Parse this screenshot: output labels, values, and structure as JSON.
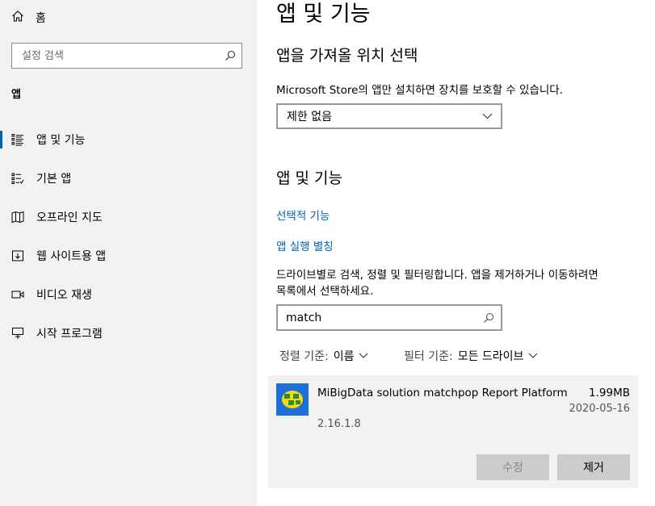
{
  "sidebar": {
    "home_label": "홈",
    "search_placeholder": "설정 검색",
    "section_title": "앱",
    "items": [
      {
        "label": "앱 및 기능",
        "icon": "apps-features-icon",
        "active": true
      },
      {
        "label": "기본 앱",
        "icon": "default-apps-icon"
      },
      {
        "label": "오프라인 지도",
        "icon": "offline-maps-icon"
      },
      {
        "label": "웹 사이트용 앱",
        "icon": "apps-for-websites-icon"
      },
      {
        "label": "비디오 재생",
        "icon": "video-playback-icon"
      },
      {
        "label": "시작 프로그램",
        "icon": "startup-icon"
      }
    ]
  },
  "main": {
    "page_title": "앱 및 기능",
    "source_title": "앱을 가져올 위치 선택",
    "source_desc": "Microsoft Store의 앱만 설치하면 장치를 보호할 수 있습니다.",
    "source_dropdown_value": "제한 없음",
    "apps_title": "앱 및 기능",
    "optional_features_link": "선택적 기능",
    "app_aliases_link": "앱 실행 별칭",
    "filter_desc_line1": "드라이브별로 검색, 정렬 및 필터링합니다. 앱을 제거하거나 이동하려면",
    "filter_desc_line2": "목록에서 선택하세요.",
    "filter_value": "match",
    "sort_label": "정렬 기준:",
    "sort_value": "이름",
    "filter_label": "필터 기준:",
    "filter_by_value": "모든 드라이브",
    "app": {
      "name": "MiBigData solution matchpop Report Platform",
      "size": "1.99MB",
      "date": "2020-05-16",
      "version": "2.16.1.8",
      "modify_label": "수정",
      "uninstall_label": "제거"
    }
  },
  "colors": {
    "accent": "#0063b1",
    "sidebar_bg": "#f2f2f2",
    "card_bg": "#f2f2f2",
    "app_icon_bg": "#1e6fd9",
    "app_icon_fg": "#f5d90a"
  }
}
